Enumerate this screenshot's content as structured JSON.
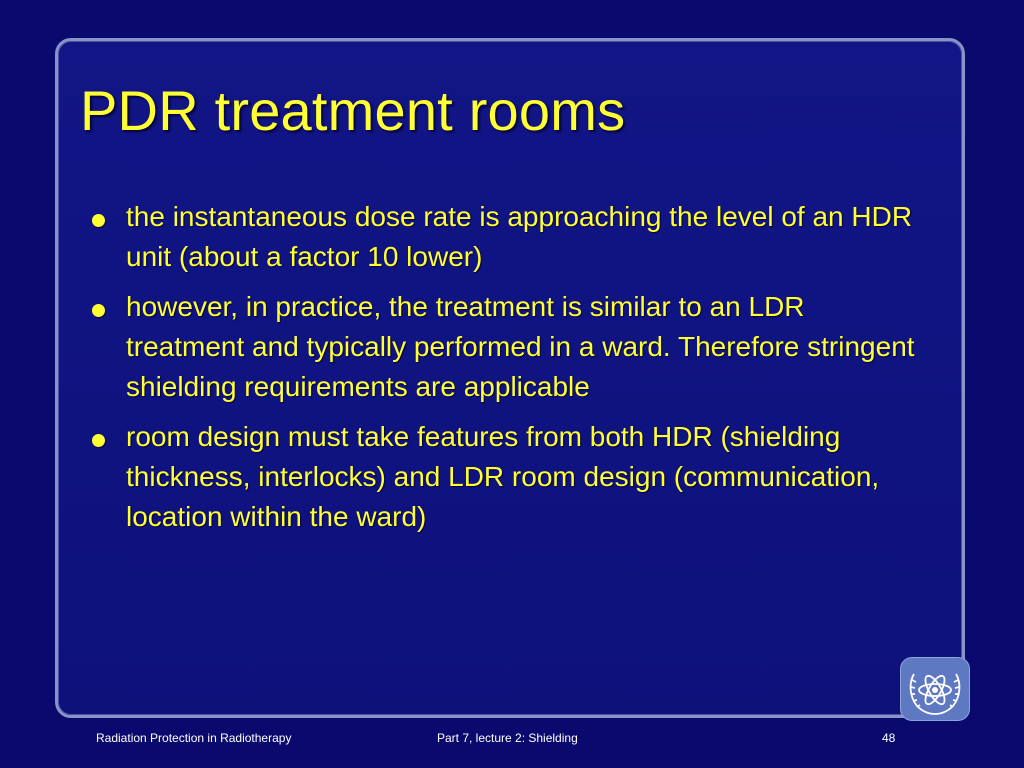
{
  "slide": {
    "title": "PDR treatment rooms",
    "bullets": [
      "the instantaneous dose rate is approaching the level of an HDR unit (about a factor 10 lower)",
      "however, in practice, the treatment is similar to an LDR treatment and typically performed in a ward. Therefore stringent shielding requirements are applicable",
      "room design must take features from both HDR (shielding thickness, interlocks) and LDR room design (communication, location within the ward)"
    ],
    "logo_icon": "iaea-atom-logo-icon"
  },
  "footer": {
    "left": "Radiation Protection in Radiotherapy",
    "center": "Part 7, lecture 2: Shielding",
    "page_number": "48"
  },
  "colors": {
    "background": "#0a0a6e",
    "text": "#ffff33",
    "frame_border": "#8a93c8",
    "footer_text": "#ffffff"
  }
}
